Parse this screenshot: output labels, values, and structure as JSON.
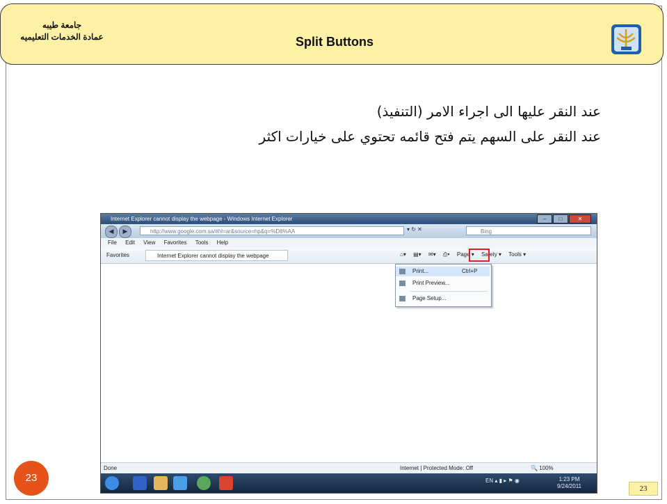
{
  "header": {
    "university_line1": "جامعة طيبه",
    "university_line2": "عمادة الخدمات التعليميه",
    "title": "Split Buttons"
  },
  "body": {
    "line1": "عند النقر عليها الى اجراء الامر (التنفيذ)",
    "line2": "عند النقر على السهم يتم فتح قائمه تحتوي على خيارات اكثر"
  },
  "screenshot": {
    "window_title": "Internet Explorer cannot display the webpage - Windows Internet Explorer",
    "address": "http://www.google.com.sa/#hl=ar&source=hp&q=%D8%AA",
    "search_placeholder": "Bing",
    "menu": [
      "File",
      "Edit",
      "View",
      "Favorites",
      "Tools",
      "Help"
    ],
    "favorites_label": "Favorites",
    "tab_label": "Internet Explorer cannot display the webpage",
    "commands": [
      "Page ▾",
      "Safety ▾",
      "Tools ▾"
    ],
    "print_menu": [
      {
        "label": "Print...",
        "shortcut": "Ctrl+P"
      },
      {
        "label": "Print Preview..."
      },
      {
        "label": "Page Setup..."
      }
    ],
    "status_left": "Done",
    "status_zone": "Internet | Protected Mode: Off",
    "zoom": "100%",
    "tray_lang": "EN",
    "clock_time": "1:23 PM",
    "clock_date": "9/24/2011"
  },
  "page_number": "23",
  "colors": {
    "header_bg": "#fcf1a4",
    "badge_orange": "#e5531b",
    "highlight_red": "#e01e1e"
  }
}
